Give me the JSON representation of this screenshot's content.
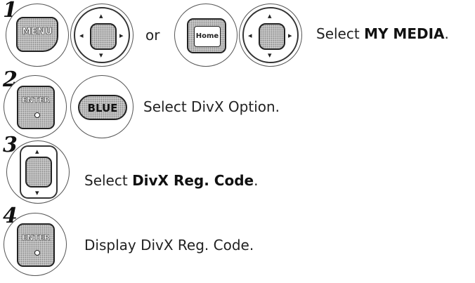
{
  "steps": [
    {
      "number": "1",
      "keys": {
        "menu": "MENU",
        "home": "Home"
      },
      "or_label": "or",
      "instruction_prefix": "Select ",
      "instruction_bold": "MY MEDIA",
      "instruction_suffix": "."
    },
    {
      "number": "2",
      "keys": {
        "enter": "ENTER",
        "blue": "BLUE"
      },
      "instruction": "Select DivX Option."
    },
    {
      "number": "3",
      "instruction_prefix": "Select ",
      "instruction_bold": "DivX Reg. Code",
      "instruction_suffix": "."
    },
    {
      "number": "4",
      "keys": {
        "enter": "ENTER"
      },
      "instruction": "Display DivX Reg. Code."
    }
  ],
  "icons": {
    "arrow_up": "▴",
    "arrow_down": "▾",
    "arrow_left": "◂",
    "arrow_right": "▸"
  }
}
